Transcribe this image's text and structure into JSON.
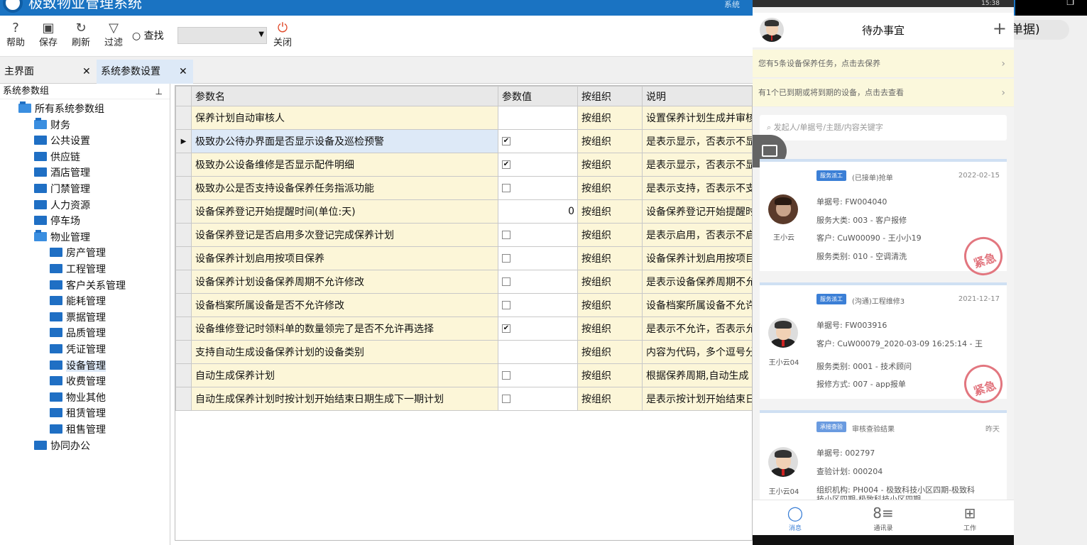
{
  "app": {
    "title": "极致物业管理系统",
    "title_extra": "系统"
  },
  "toolbar": {
    "help": "帮助",
    "save": "保存",
    "refresh": "刷新",
    "filter": "过滤",
    "find": "查找",
    "find_value": "",
    "close": "关闭"
  },
  "pill_text": "单据)",
  "tabs": [
    {
      "label": "主界面"
    },
    {
      "label": "系统参数设置"
    }
  ],
  "tree": {
    "header": "系统参数组",
    "root": "所有系统参数组",
    "items": [
      "财务",
      "公共设置",
      "供应链",
      "酒店管理",
      "门禁管理",
      "人力资源",
      "停车场",
      "物业管理"
    ],
    "sub_items": [
      "房产管理",
      "工程管理",
      "客户关系管理",
      "能耗管理",
      "票据管理",
      "品质管理",
      "凭证管理",
      "设备管理",
      "收费管理",
      "物业其他",
      "租赁管理",
      "租售管理"
    ],
    "last": "协同办公",
    "selected": "设备管理"
  },
  "grid": {
    "headers": [
      "参数名",
      "参数值",
      "按组织",
      "说明"
    ],
    "rows": [
      {
        "name": "保养计划自动审核人",
        "value": "",
        "checkbox": false,
        "checked": false,
        "org": "按组织",
        "desc": "设置保养计划生成并审核"
      },
      {
        "name": "极致办公待办界面是否显示设备及巡检预警",
        "value": "",
        "checkbox": true,
        "checked": true,
        "org": "按组织",
        "desc": "是表示显示，否表示不显"
      },
      {
        "name": "极致办公设备维修是否显示配件明细",
        "value": "",
        "checkbox": true,
        "checked": true,
        "org": "按组织",
        "desc": "是表示显示，否表示不显"
      },
      {
        "name": "极致办公是否支持设备保养任务指派功能",
        "value": "",
        "checkbox": true,
        "checked": false,
        "org": "按组织",
        "desc": "是表示支持，否表示不支"
      },
      {
        "name": "设备保养登记开始提醒时间(单位:天)",
        "value": "0",
        "checkbox": false,
        "checked": false,
        "org": "按组织",
        "desc": "设备保养登记开始提醒时"
      },
      {
        "name": "设备保养登记是否启用多次登记完成保养计划",
        "value": "",
        "checkbox": true,
        "checked": false,
        "org": "按组织",
        "desc": "是表示启用，否表示不启"
      },
      {
        "name": "设备保养计划启用按项目保养",
        "value": "",
        "checkbox": true,
        "checked": false,
        "org": "按组织",
        "desc": "设备保养计划启用按项目"
      },
      {
        "name": "设备保养计划设备保养周期不允许修改",
        "value": "",
        "checkbox": true,
        "checked": false,
        "org": "按组织",
        "desc": "是表示设备保养周期不允"
      },
      {
        "name": "设备档案所属设备是否不允许修改",
        "value": "",
        "checkbox": true,
        "checked": false,
        "org": "按组织",
        "desc": "设备档案所属设备不允许"
      },
      {
        "name": "设备维修登记时领料单的数量领完了是否不允许再选择",
        "value": "",
        "checkbox": true,
        "checked": true,
        "org": "按组织",
        "desc": "是表示不允许，否表示允"
      },
      {
        "name": "支持自动生成设备保养计划的设备类别",
        "value": "",
        "checkbox": false,
        "checked": false,
        "org": "按组织",
        "desc": "内容为代码，多个逗号分"
      },
      {
        "name": "自动生成保养计划",
        "value": "",
        "checkbox": true,
        "checked": false,
        "org": "按组织",
        "desc": "根据保养周期,自动生成"
      },
      {
        "name": "自动生成保养计划时按计划开始结束日期生成下一期计划",
        "value": "",
        "checkbox": true,
        "checked": false,
        "org": "按组织",
        "desc": "是表示按计划开始结束日"
      }
    ]
  },
  "phone": {
    "status_right": "15:38",
    "header_title": "待办事宜",
    "notices": [
      "您有5条设备保养任务，点击去保养",
      "有1个已到期或将到期的设备，点击去查看"
    ],
    "search_placeholder": "发起人/单据号/主题/内容关键字",
    "cards": [
      {
        "badge": "服务派工",
        "status": "(已接单)抢单",
        "date": "2022-02-15",
        "who": "王小云",
        "lines": [
          "单据号:  FW004040",
          "服务大类:  003 - 客户报修",
          "客户:  CuW00090 - 王小小19",
          "服务类别:  010 - 空调清洗"
        ],
        "stamp": "紧急"
      },
      {
        "badge": "服务派工",
        "status": "(沟通)工程维修3",
        "date": "2021-12-17",
        "who": "王小云04",
        "lines": [
          "单据号:  FW003916",
          "客户:  CuW00079_2020-03-09 16:25:14 - 王",
          "服务类别:  0001 - 技术顾问",
          "报修方式:  007 - app报单"
        ],
        "stamp": "紧急"
      },
      {
        "badge": "承接查验",
        "status": "审核查验结果",
        "date": "昨天",
        "who": "王小云04",
        "lines": [
          "单据号:  002797",
          "查验计划:  000204",
          "组织机构:  PH004 - 极致科技小区四期-极致科",
          "技小区四期-极致科技小区四期"
        ]
      }
    ],
    "nav": [
      "消息",
      "通讯录",
      "工作"
    ]
  },
  "colors": {
    "titlebar": "#1a73c2",
    "selected": "#dde9f7",
    "cell_yellow": "#fcf6d8",
    "accent": "#3b7fd6"
  }
}
